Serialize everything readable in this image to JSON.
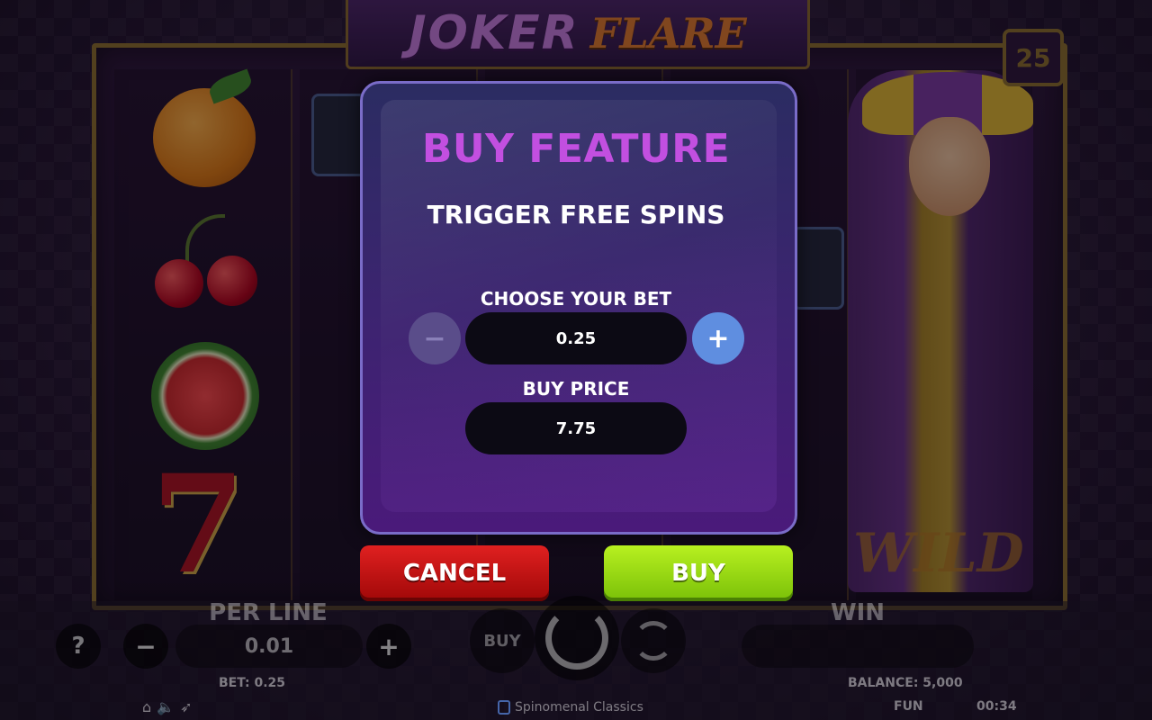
{
  "game": {
    "logo_part1": "JOKER",
    "logo_part2": "FLARE",
    "paylines": "25",
    "wild_label": "WILD"
  },
  "modal": {
    "title": "BUY FEATURE",
    "subtitle": "TRIGGER FREE SPINS",
    "choose_bet_label": "CHOOSE YOUR BET",
    "bet_value": "0.25",
    "buy_price_label": "BUY PRICE",
    "buy_price_value": "7.75",
    "minus_symbol": "−",
    "plus_symbol": "+",
    "cancel_label": "CANCEL",
    "buy_label": "BUY"
  },
  "controls": {
    "help_symbol": "?",
    "per_line_label": "PER LINE",
    "per_line_value": "0.01",
    "minus_symbol": "−",
    "plus_symbol": "+",
    "buy_label": "BUY",
    "win_label": "WIN"
  },
  "status": {
    "bet": "BET: 0.25",
    "balance": "BALANCE: 5,000",
    "mode": "FUN",
    "time": "00:34",
    "brand": "Spinomenal Classics"
  },
  "icons": {
    "home": "home-icon",
    "sound": "sound-icon",
    "turbo": "turbo-icon"
  }
}
